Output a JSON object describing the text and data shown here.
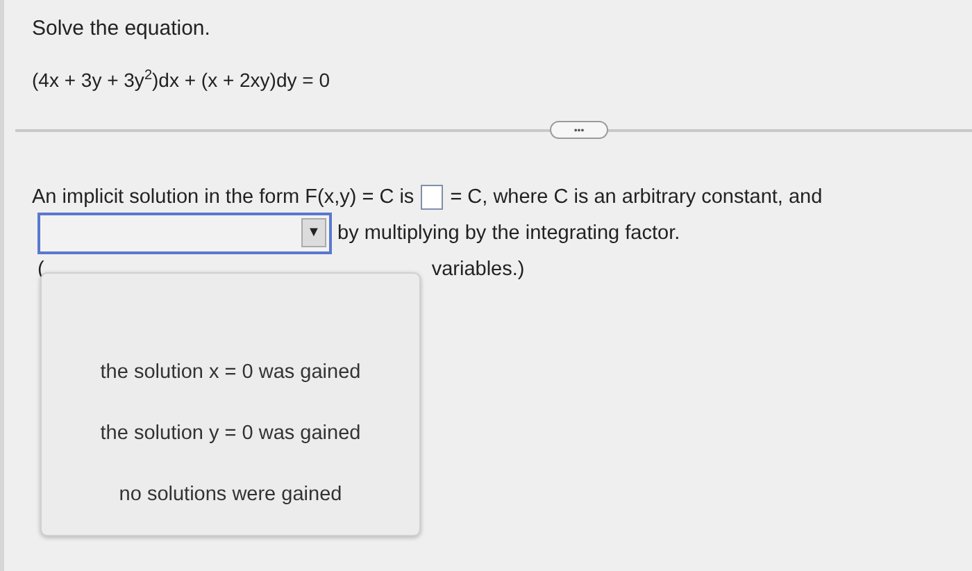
{
  "question": {
    "prompt": "Solve the equation.",
    "equation": "(4x + 3y + 3y$^{2}$)dx + (x + 2xy)dy = 0"
  },
  "more_button": {
    "label": "•••"
  },
  "answer": {
    "line_1_before": "An implicit solution in the form F(x,y) = C is",
    "line_1_after": "= C, where C is an arbitrary constant, and",
    "line_2_after": "by multiplying by the integrating factor.",
    "line_3_before": "(",
    "line_3_after": "variables.)"
  },
  "dropdown": {
    "arrow": "▼",
    "expanded": true,
    "options": [
      {
        "label": "the solution x = 0 was gained",
        "selected": false
      },
      {
        "label": "the solution y = 0 was gained",
        "selected": false
      },
      {
        "label": "no solutions were gained",
        "selected": false
      }
    ]
  }
}
